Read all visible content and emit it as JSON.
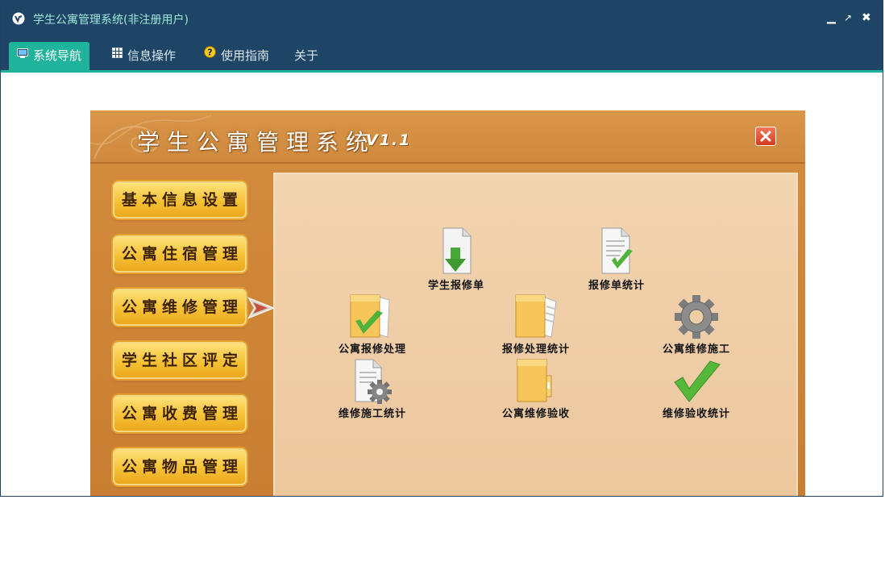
{
  "window": {
    "title": "学生公寓管理系统(非注册用户)",
    "controls": {
      "minimize": "▁",
      "maximize": "↗",
      "close": "✖"
    }
  },
  "menu": [
    {
      "label": "系统导航",
      "icon": "monitor-icon",
      "active": true
    },
    {
      "label": "信息操作",
      "icon": "grid-icon",
      "active": false
    },
    {
      "label": "使用指南",
      "icon": "help-icon",
      "active": false
    },
    {
      "label": "关于",
      "icon": "",
      "active": false
    }
  ],
  "app": {
    "title": "学生公寓管理系统",
    "version": "V1.1",
    "nav": [
      {
        "label": "基本信息设置"
      },
      {
        "label": "公寓住宿管理"
      },
      {
        "label": "公寓维修管理",
        "selected": true
      },
      {
        "label": "学生社区评定"
      },
      {
        "label": "公寓收费管理"
      },
      {
        "label": "公寓物品管理"
      }
    ],
    "functions": [
      {
        "label": "学生报修单",
        "icon": "document-download-icon"
      },
      {
        "label": "报修单统计",
        "icon": "document-check-icon"
      },
      {
        "label": "公寓报修处理",
        "icon": "folder-check-icon"
      },
      {
        "label": "报修处理统计",
        "icon": "folder-document-icon"
      },
      {
        "label": "公寓维修施工",
        "icon": "gear-icon"
      },
      {
        "label": "维修施工统计",
        "icon": "document-gear-icon"
      },
      {
        "label": "公寓维修验收",
        "icon": "folder-icon"
      },
      {
        "label": "维修验收统计",
        "icon": "check-icon"
      }
    ]
  },
  "colors": {
    "titlebar": "#1e4565",
    "accent": "#20b39c",
    "title_text": "#9fe6dc",
    "button_gold": "#f6c136",
    "panel": "#efcda6"
  }
}
